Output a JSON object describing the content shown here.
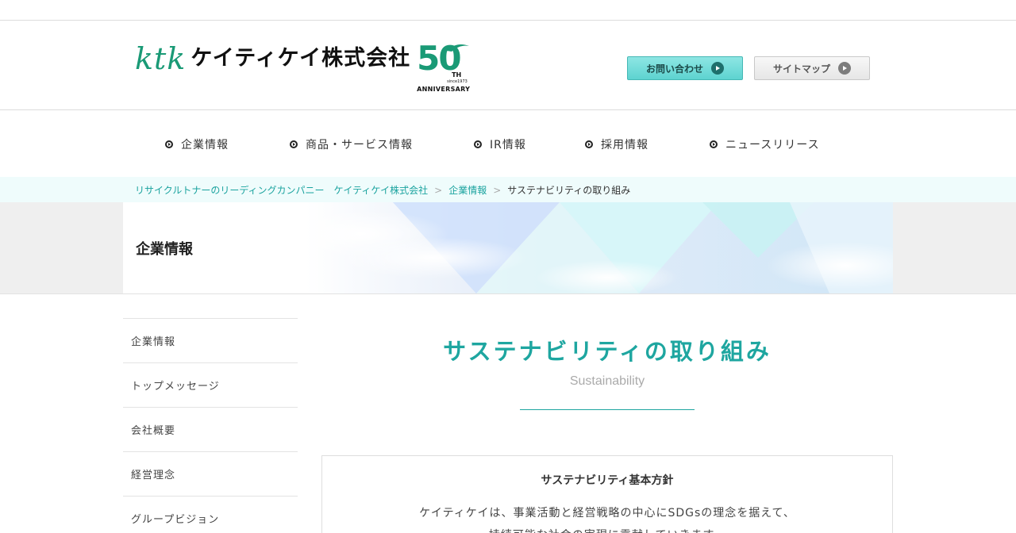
{
  "header": {
    "logo": {
      "ktk": "ktk",
      "company_name": "ケイティケイ株式会社",
      "anniversary_number": "50",
      "anniversary_suffix": "TH",
      "since": "since1973",
      "anniversary_label": "ANNIVERSARY"
    },
    "contact_button": "お問い合わせ",
    "sitemap_button": "サイトマップ",
    "brand_color": "#1a9a76",
    "accent_color": "#1ea6a0"
  },
  "global_nav": [
    {
      "label": "企業情報"
    },
    {
      "label": "商品・サービス情報"
    },
    {
      "label": "IR情報"
    },
    {
      "label": "採用情報"
    },
    {
      "label": "ニュースリリース"
    }
  ],
  "breadcrumb": {
    "home": "リサイクルトナーのリーディングカンパニー　ケイティケイ株式会社",
    "section": "企業情報",
    "separator": ">",
    "current": "サステナビリティの取り組み"
  },
  "hero": {
    "title": "企業情報"
  },
  "sidebar": [
    {
      "label": "企業情報"
    },
    {
      "label": "トップメッセージ"
    },
    {
      "label": "会社概要"
    },
    {
      "label": "経営理念"
    },
    {
      "label": "グループビジョン"
    }
  ],
  "main": {
    "title": "サステナビリティの取り組み",
    "subtitle": "Sustainability",
    "policy": {
      "title": "サステナビリティ基本方針",
      "line1": "ケイティケイは、事業活動と経営戦略の中心にSDGsの理念を据えて、",
      "line2": "持続可能な社会の実現に貢献していきます。"
    }
  }
}
